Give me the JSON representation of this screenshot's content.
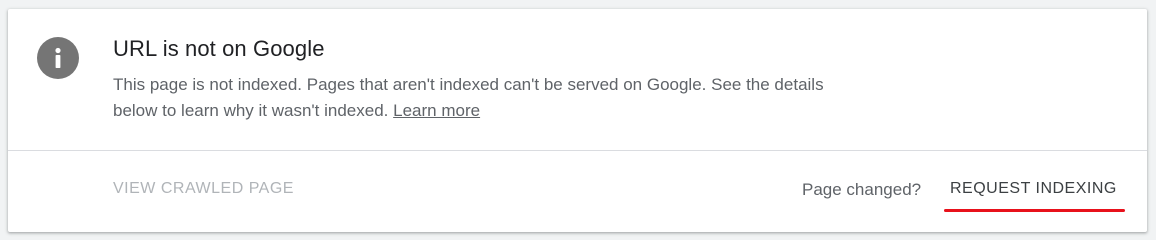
{
  "status_card": {
    "icon": "info-icon",
    "title": "URL is not on Google",
    "description": "This page is not indexed. Pages that aren't indexed can't be served on Google. See the details below to learn why it wasn't indexed.",
    "learn_more_label": "Learn more"
  },
  "actions": {
    "view_crawled_label": "VIEW CRAWLED PAGE",
    "page_changed_text": "Page changed?",
    "request_indexing_label": "REQUEST INDEXING"
  },
  "colors": {
    "highlight": "#e8111b",
    "icon": "#757575",
    "disabled_text": "#b0b4b8"
  }
}
